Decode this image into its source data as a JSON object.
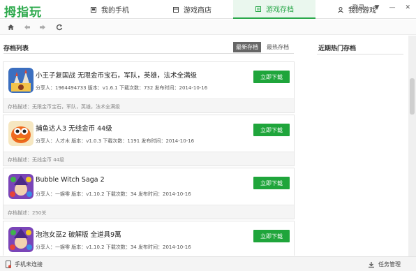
{
  "app": {
    "logo": "拇指玩"
  },
  "nav": {
    "tabs": [
      {
        "label": "我的手机",
        "icon": "phone-icon"
      },
      {
        "label": "游戏商店",
        "icon": "store-icon"
      },
      {
        "label": "游戏存档",
        "icon": "archive-icon",
        "active": true
      },
      {
        "label": "我的游戏",
        "icon": "user-icon"
      }
    ]
  },
  "window": {
    "login": "登录",
    "dropdown": "▼",
    "minimize": "—",
    "close": "✕"
  },
  "toolbar": {
    "home": "home-icon",
    "back": "back-icon",
    "forward": "forward-icon",
    "refresh": "refresh-icon"
  },
  "list": {
    "title": "存档列表",
    "sort_latest": "最新存档",
    "sort_hot": "最热存档",
    "download_label": "立即下载",
    "items": [
      {
        "title": "小王子复国战 无限金币宝石，军队，英雄，法术全满级",
        "meta": "分享人：1964494733 版本：v1.6.1 下载次数：732 发布时间：2014-10-16",
        "desc": "存档描述：无限金币宝石，军队，英雄，法术全满级",
        "icon": "castle-game-icon"
      },
      {
        "title": "捕鱼达人3 无线金币 44级",
        "meta": "分享人：人才木 版本：v1.0.3 下载次数：1191 发布时间：2014-10-16",
        "desc": "存档描述：无线金币 44级",
        "icon": "fish-game-icon"
      },
      {
        "title": "Bubble Witch Saga 2",
        "meta": "分享人：一娱零 版本：v1.10.2 下载次数：34 发布时间：2014-10-16",
        "desc": "存档描述：250关",
        "icon": "witch-game-icon"
      },
      {
        "title": "泡泡女巫2 破解版 全道具9萬",
        "meta": "分享人：一娱零 版本：v1.10.2 下载次数：34 发布时间：2014-10-16",
        "desc": "",
        "icon": "witch-game-icon"
      }
    ]
  },
  "right": {
    "title": "近期热门存档"
  },
  "status": {
    "phone": "手机未连接",
    "tasks": "任务管理"
  },
  "colors": {
    "accent": "#2aa84a",
    "button": "#1fa53b"
  }
}
